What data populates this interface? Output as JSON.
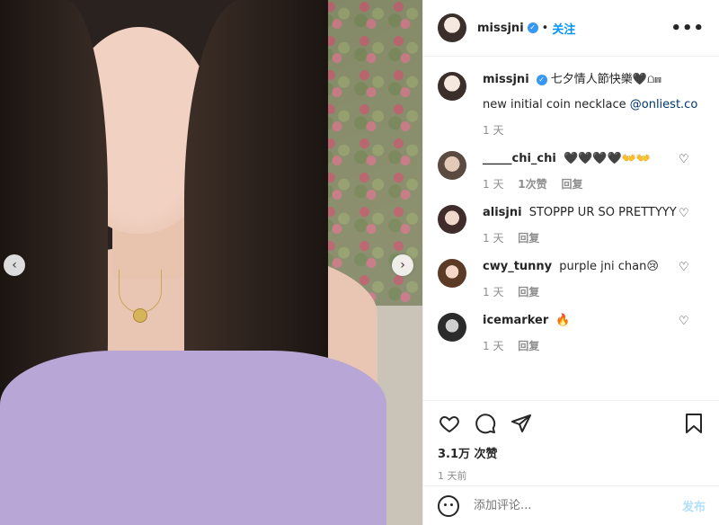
{
  "post": {
    "username": "missjni",
    "follow_label": "关注",
    "more_label": "•••"
  },
  "caption": {
    "username": "missjni",
    "text": "七夕情人節快樂🖤⩍⩎",
    "line2_text": "new initial coin necklace ",
    "line2_mention": "@onliest.co",
    "time": "1 天"
  },
  "comments": [
    {
      "name": "_____chi_chi",
      "text": "🖤🖤🖤🖤👐👐",
      "time": "1 天",
      "likes": "1次赞",
      "reply": "回复"
    },
    {
      "name": "alisjni",
      "text": "STOPPP UR SO PRETTYYY",
      "time": "1 天",
      "likes": "",
      "reply": "回复"
    },
    {
      "name": "cwy_tunny",
      "text": "purple jni chan😢",
      "time": "1 天",
      "likes": "",
      "reply": "回复"
    },
    {
      "name": "icemarker",
      "text": "🔥",
      "time": "1 天",
      "likes": "",
      "reply": "回复"
    }
  ],
  "stats": {
    "likes": "3.1万 次赞",
    "time": "1 天前"
  },
  "composer": {
    "placeholder": "添加评论...",
    "post_label": "发布"
  },
  "nav": {
    "prev": "‹",
    "next": "›"
  },
  "colors": {
    "accent": "#0095f6",
    "muted": "#8e8e8e"
  }
}
